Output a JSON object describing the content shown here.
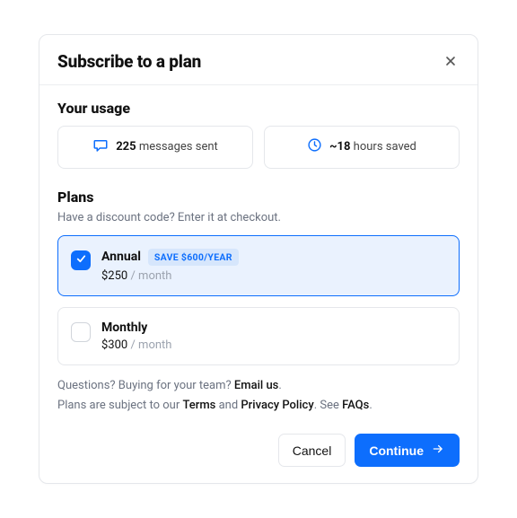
{
  "header": {
    "title": "Subscribe to a plan"
  },
  "usage": {
    "title": "Your usage",
    "cards": [
      {
        "value": "225",
        "label": "messages sent"
      },
      {
        "value": "~18",
        "label": "hours saved"
      }
    ]
  },
  "plans": {
    "title": "Plans",
    "subtitle": "Have a discount code? Enter it at checkout.",
    "items": [
      {
        "name": "Annual",
        "badge": "SAVE $600/YEAR",
        "price": "$250",
        "per": " / month",
        "selected": true
      },
      {
        "name": "Monthly",
        "badge": "",
        "price": "$300",
        "per": " / month",
        "selected": false
      }
    ]
  },
  "footnotes": {
    "line1_prefix": "Questions? Buying for your team? ",
    "email_link": "Email us",
    "line1_suffix": ".",
    "line2_prefix": "Plans are subject to our ",
    "terms_link": "Terms",
    "and": " and ",
    "privacy_link": "Privacy Policy",
    "line2_mid": ". See ",
    "faqs_link": "FAQs",
    "line2_suffix": "."
  },
  "footer": {
    "cancel": "Cancel",
    "continue": "Continue"
  },
  "colors": {
    "accent": "#0d6efd"
  }
}
